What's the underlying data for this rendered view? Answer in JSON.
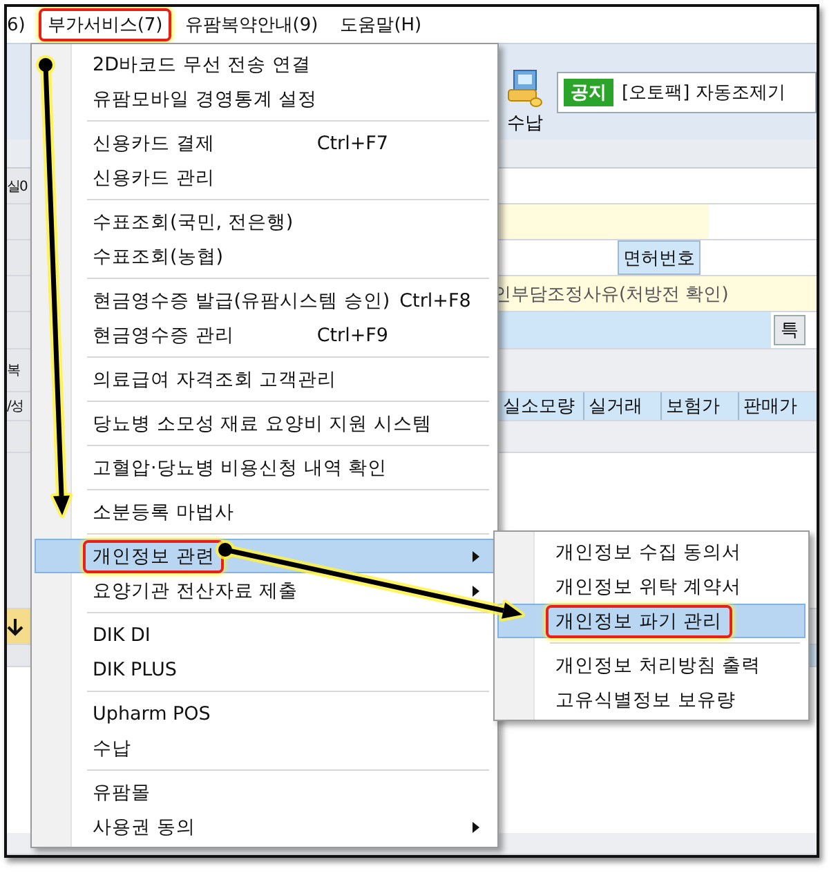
{
  "menubar": [
    {
      "label": "6)",
      "annotated": false
    },
    {
      "label": "부가서비스(7)",
      "annotated": true
    },
    {
      "label": "유팜복약안내(9)",
      "annotated": false
    },
    {
      "label": "도움말(H)",
      "annotated": false
    }
  ],
  "toolbar": {
    "button": "수납",
    "notice": {
      "badge": "공지",
      "text": "[오토팩] 자동조제기"
    }
  },
  "form": {
    "left_labels": [
      "실0",
      "복",
      "/성"
    ],
    "license_label": "면허번호",
    "hint": "인부담조정사유(처방전 확인)",
    "button": "특",
    "columns": [
      "실소모량",
      "실거래",
      "보험가",
      "판매가"
    ]
  },
  "menu": {
    "groups": [
      [
        {
          "label": "2D바코드 무선 전송 연결",
          "selected": false,
          "annotated": false,
          "has_submenu": false
        },
        {
          "label": "유팜모바일 경영통계 설정",
          "selected": false,
          "annotated": false,
          "has_submenu": false
        }
      ],
      [
        {
          "label": "신용카드 결제",
          "shortcut": "Ctrl+F7",
          "selected": false,
          "annotated": false,
          "has_submenu": false
        },
        {
          "label": "신용카드 관리",
          "selected": false,
          "annotated": false,
          "has_submenu": false
        }
      ],
      [
        {
          "label": "수표조회(국민, 전은행)",
          "selected": false,
          "annotated": false,
          "has_submenu": false
        },
        {
          "label": "수표조회(농협)",
          "selected": false,
          "annotated": false,
          "has_submenu": false
        }
      ],
      [
        {
          "label": "현금영수증 발급(유팜시스템 승인)",
          "shortcut": "Ctrl+F8",
          "selected": false,
          "annotated": false,
          "has_submenu": false
        },
        {
          "label": "현금영수증 관리",
          "shortcut": "Ctrl+F9",
          "selected": false,
          "annotated": false,
          "has_submenu": false
        }
      ],
      [
        {
          "label": "의료급여 자격조회 고객관리",
          "selected": false,
          "annotated": false,
          "has_submenu": false
        }
      ],
      [
        {
          "label": "당뇨병 소모성 재료 요양비 지원 시스템",
          "selected": false,
          "annotated": false,
          "has_submenu": false
        }
      ],
      [
        {
          "label": "고혈압·당뇨병 비용신청 내역 확인",
          "selected": false,
          "annotated": false,
          "has_submenu": false
        }
      ],
      [
        {
          "label": "소분등록 마법사",
          "selected": false,
          "annotated": false,
          "has_submenu": false
        }
      ],
      [
        {
          "label": "개인정보 관련",
          "selected": true,
          "annotated": true,
          "has_submenu": true
        },
        {
          "label": "요양기관 전산자료 제출",
          "selected": false,
          "annotated": false,
          "has_submenu": true
        }
      ],
      [
        {
          "label": "DIK DI",
          "selected": false,
          "annotated": false,
          "has_submenu": false
        },
        {
          "label": "DIK PLUS",
          "selected": false,
          "annotated": false,
          "has_submenu": false
        }
      ],
      [
        {
          "label": "Upharm POS",
          "selected": false,
          "annotated": false,
          "has_submenu": false
        },
        {
          "label": "수납",
          "selected": false,
          "annotated": false,
          "has_submenu": false
        }
      ],
      [
        {
          "label": "유팜몰",
          "selected": false,
          "annotated": false,
          "has_submenu": false
        },
        {
          "label": "사용권 동의",
          "selected": false,
          "annotated": false,
          "has_submenu": true
        }
      ]
    ]
  },
  "submenu": {
    "groups": [
      [
        {
          "label": "개인정보 수집 동의서",
          "selected": false,
          "annotated": false,
          "has_submenu": false
        },
        {
          "label": "개인정보 위탁 계약서",
          "selected": false,
          "annotated": false,
          "has_submenu": false
        },
        {
          "label": "개인정보 파기 관리",
          "selected": true,
          "annotated": true,
          "has_submenu": false
        }
      ],
      [
        {
          "label": "개인정보 처리방침 출력",
          "selected": false,
          "annotated": false,
          "has_submenu": false
        },
        {
          "label": "고유식별정보 보유량",
          "selected": false,
          "annotated": false,
          "has_submenu": false
        }
      ]
    ]
  }
}
